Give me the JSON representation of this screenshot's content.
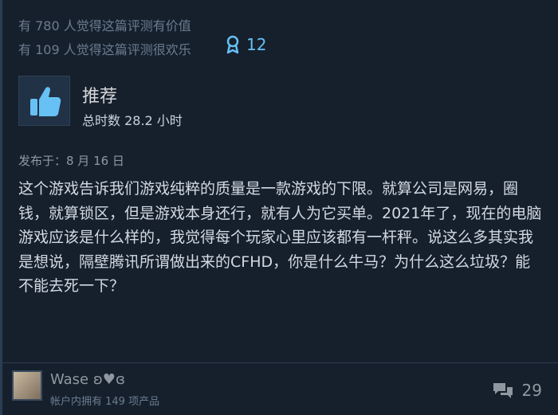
{
  "review": {
    "helpful_line": "有 780 人觉得这篇评测有价值",
    "funny_line": "有 109 人觉得这篇评测很欢乐",
    "award_count": "12",
    "recommendation": "推荐",
    "playtime": "总时数 28.2 小时",
    "posted": "发布于：8 月 16 日",
    "text": "这个游戏告诉我们游戏纯粹的质量是一款游戏的下限。就算公司是网易，圈钱，就算锁区，但是游戏本身还行，就有人为它买单。2021年了，现在的电脑游戏应该是什么样的，我觉得每个玩家心里应该都有一杆秤。说这么多其实我是想说，隔壁腾讯所谓做出来的CFHD，你是什么牛马？为什么这么垃圾？能不能去死一下？"
  },
  "author": {
    "name": "Wase ʚ♥ɞ",
    "products": "帐户内拥有 149 项产品"
  },
  "footer": {
    "comment_count": "29"
  },
  "icons": {
    "award": "award-ribbon-icon",
    "thumb": "thumbs-up-icon",
    "comments": "comment-bubbles-icon"
  },
  "colors": {
    "accent": "#66c0f4",
    "background": "#16202d"
  }
}
